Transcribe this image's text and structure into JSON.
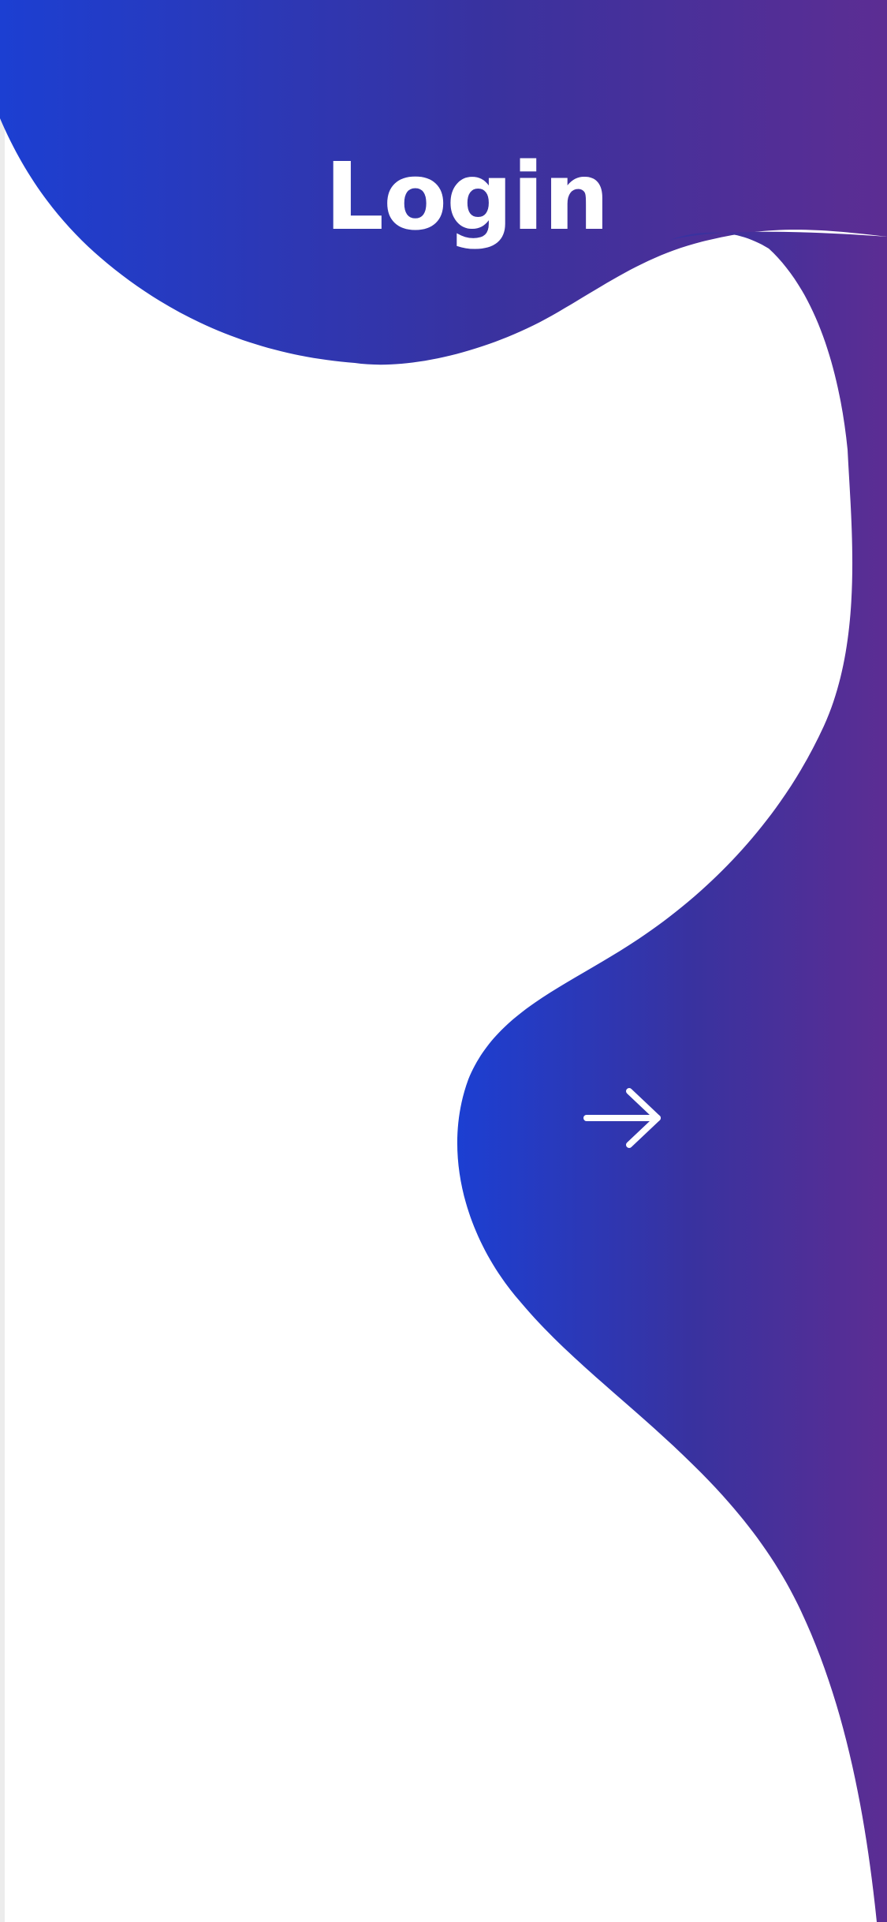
{
  "screen": {
    "title": "Login",
    "next_button_icon": "arrow-right-icon"
  },
  "colors": {
    "gradient_start": "#1c3fd2",
    "gradient_end": "#5c2d93",
    "background": "#ffffff",
    "text": "#ffffff"
  }
}
